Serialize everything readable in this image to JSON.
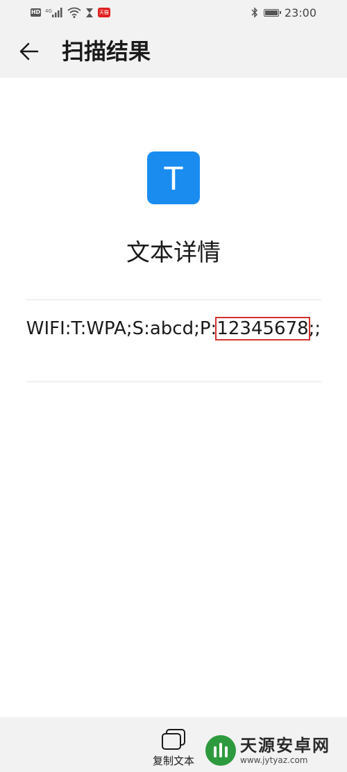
{
  "status_bar": {
    "hd_label": "HD",
    "network_label": "4G",
    "app_badge_label": "天猫",
    "time": "23:00",
    "icons": [
      "hd-icon",
      "signal-icon",
      "wifi-icon",
      "hourglass-icon",
      "app-badge-icon",
      "bluetooth-icon",
      "battery-icon"
    ]
  },
  "header": {
    "back_icon": "arrow-left-icon",
    "title": "扫描结果"
  },
  "content": {
    "type_icon_letter": "T",
    "type_icon_color": "#1a8cf0",
    "heading": "文本详情",
    "result_text_prefix": "WIFI:T:WPA;S:abcd;P:",
    "result_text_highlight": "12345678",
    "result_text_suffix": ";;",
    "highlight_color": "#d23030"
  },
  "bottom_bar": {
    "copy_icon": "copy-icon",
    "copy_label": "复制文本"
  },
  "watermark": {
    "name": "天源安卓网",
    "url": "www.jytyaz.com"
  }
}
